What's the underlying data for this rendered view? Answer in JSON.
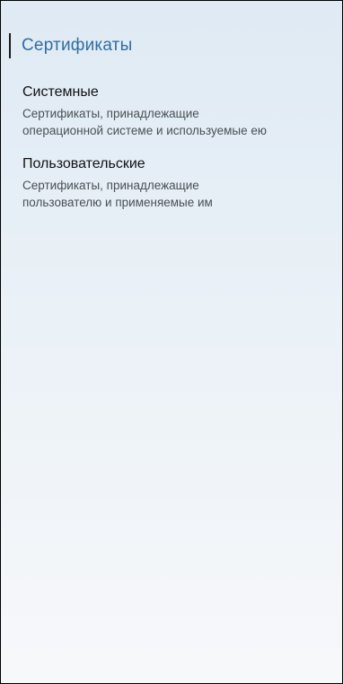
{
  "header": {
    "title": "Сертификаты"
  },
  "items": [
    {
      "title": "Системные",
      "description_line1": "Сертификаты, принадлежащие",
      "description_line2": "операционной системе и используемые ею"
    },
    {
      "title": "Пользовательские",
      "description_line1": "Сертификаты, принадлежащие",
      "description_line2": "пользователю и применяемые им"
    }
  ],
  "colors": {
    "title_accent": "#2f6ea3",
    "item_title": "#121212",
    "item_desc": "#4a4f55"
  }
}
